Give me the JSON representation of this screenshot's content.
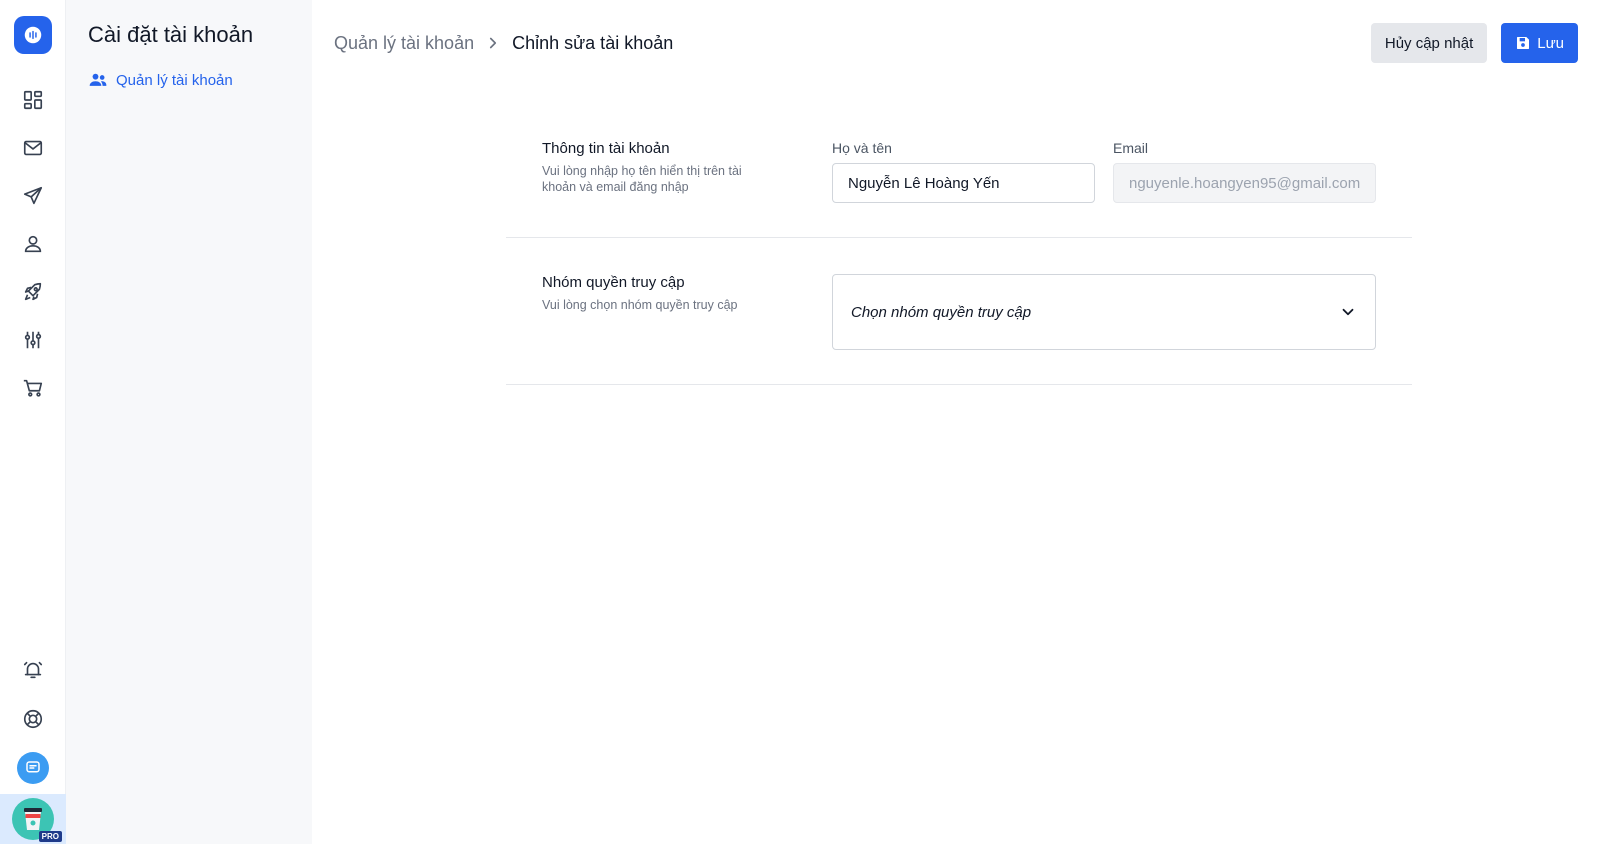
{
  "sidebar": {
    "title": "Cài đặt tài khoản",
    "items": [
      {
        "label": "Quản lý tài khoản",
        "icon": "users-icon"
      }
    ]
  },
  "rail": {
    "items": [
      "dashboard-icon",
      "mail-icon",
      "send-icon",
      "user-icon",
      "rocket-icon",
      "integrations-icon",
      "cart-icon"
    ],
    "bottom": [
      "alarm-icon",
      "help-icon",
      "chat-icon"
    ],
    "badge": "PRO"
  },
  "breadcrumb": {
    "parent": "Quản lý tài khoản",
    "current": "Chỉnh sửa tài khoản"
  },
  "actions": {
    "cancel_label": "Hủy cập nhật",
    "save_label": "Lưu"
  },
  "account_info": {
    "title": "Thông tin tài khoản",
    "description": "Vui lòng nhập họ tên hiển thị trên tài khoản và email đăng nhập",
    "name_label": "Họ và tên",
    "name_value": "Nguyễn Lê Hoàng Yến",
    "email_label": "Email",
    "email_value": "nguyenle.hoangyen95@gmail.com"
  },
  "access_group": {
    "title": "Nhóm quyền truy cập",
    "description": "Vui lòng chọn nhóm quyền truy cập",
    "select_placeholder": "Chọn nhóm quyền truy cập"
  },
  "colors": {
    "accent": "#2563eb",
    "sidebar_bg": "#f7f8fa"
  }
}
